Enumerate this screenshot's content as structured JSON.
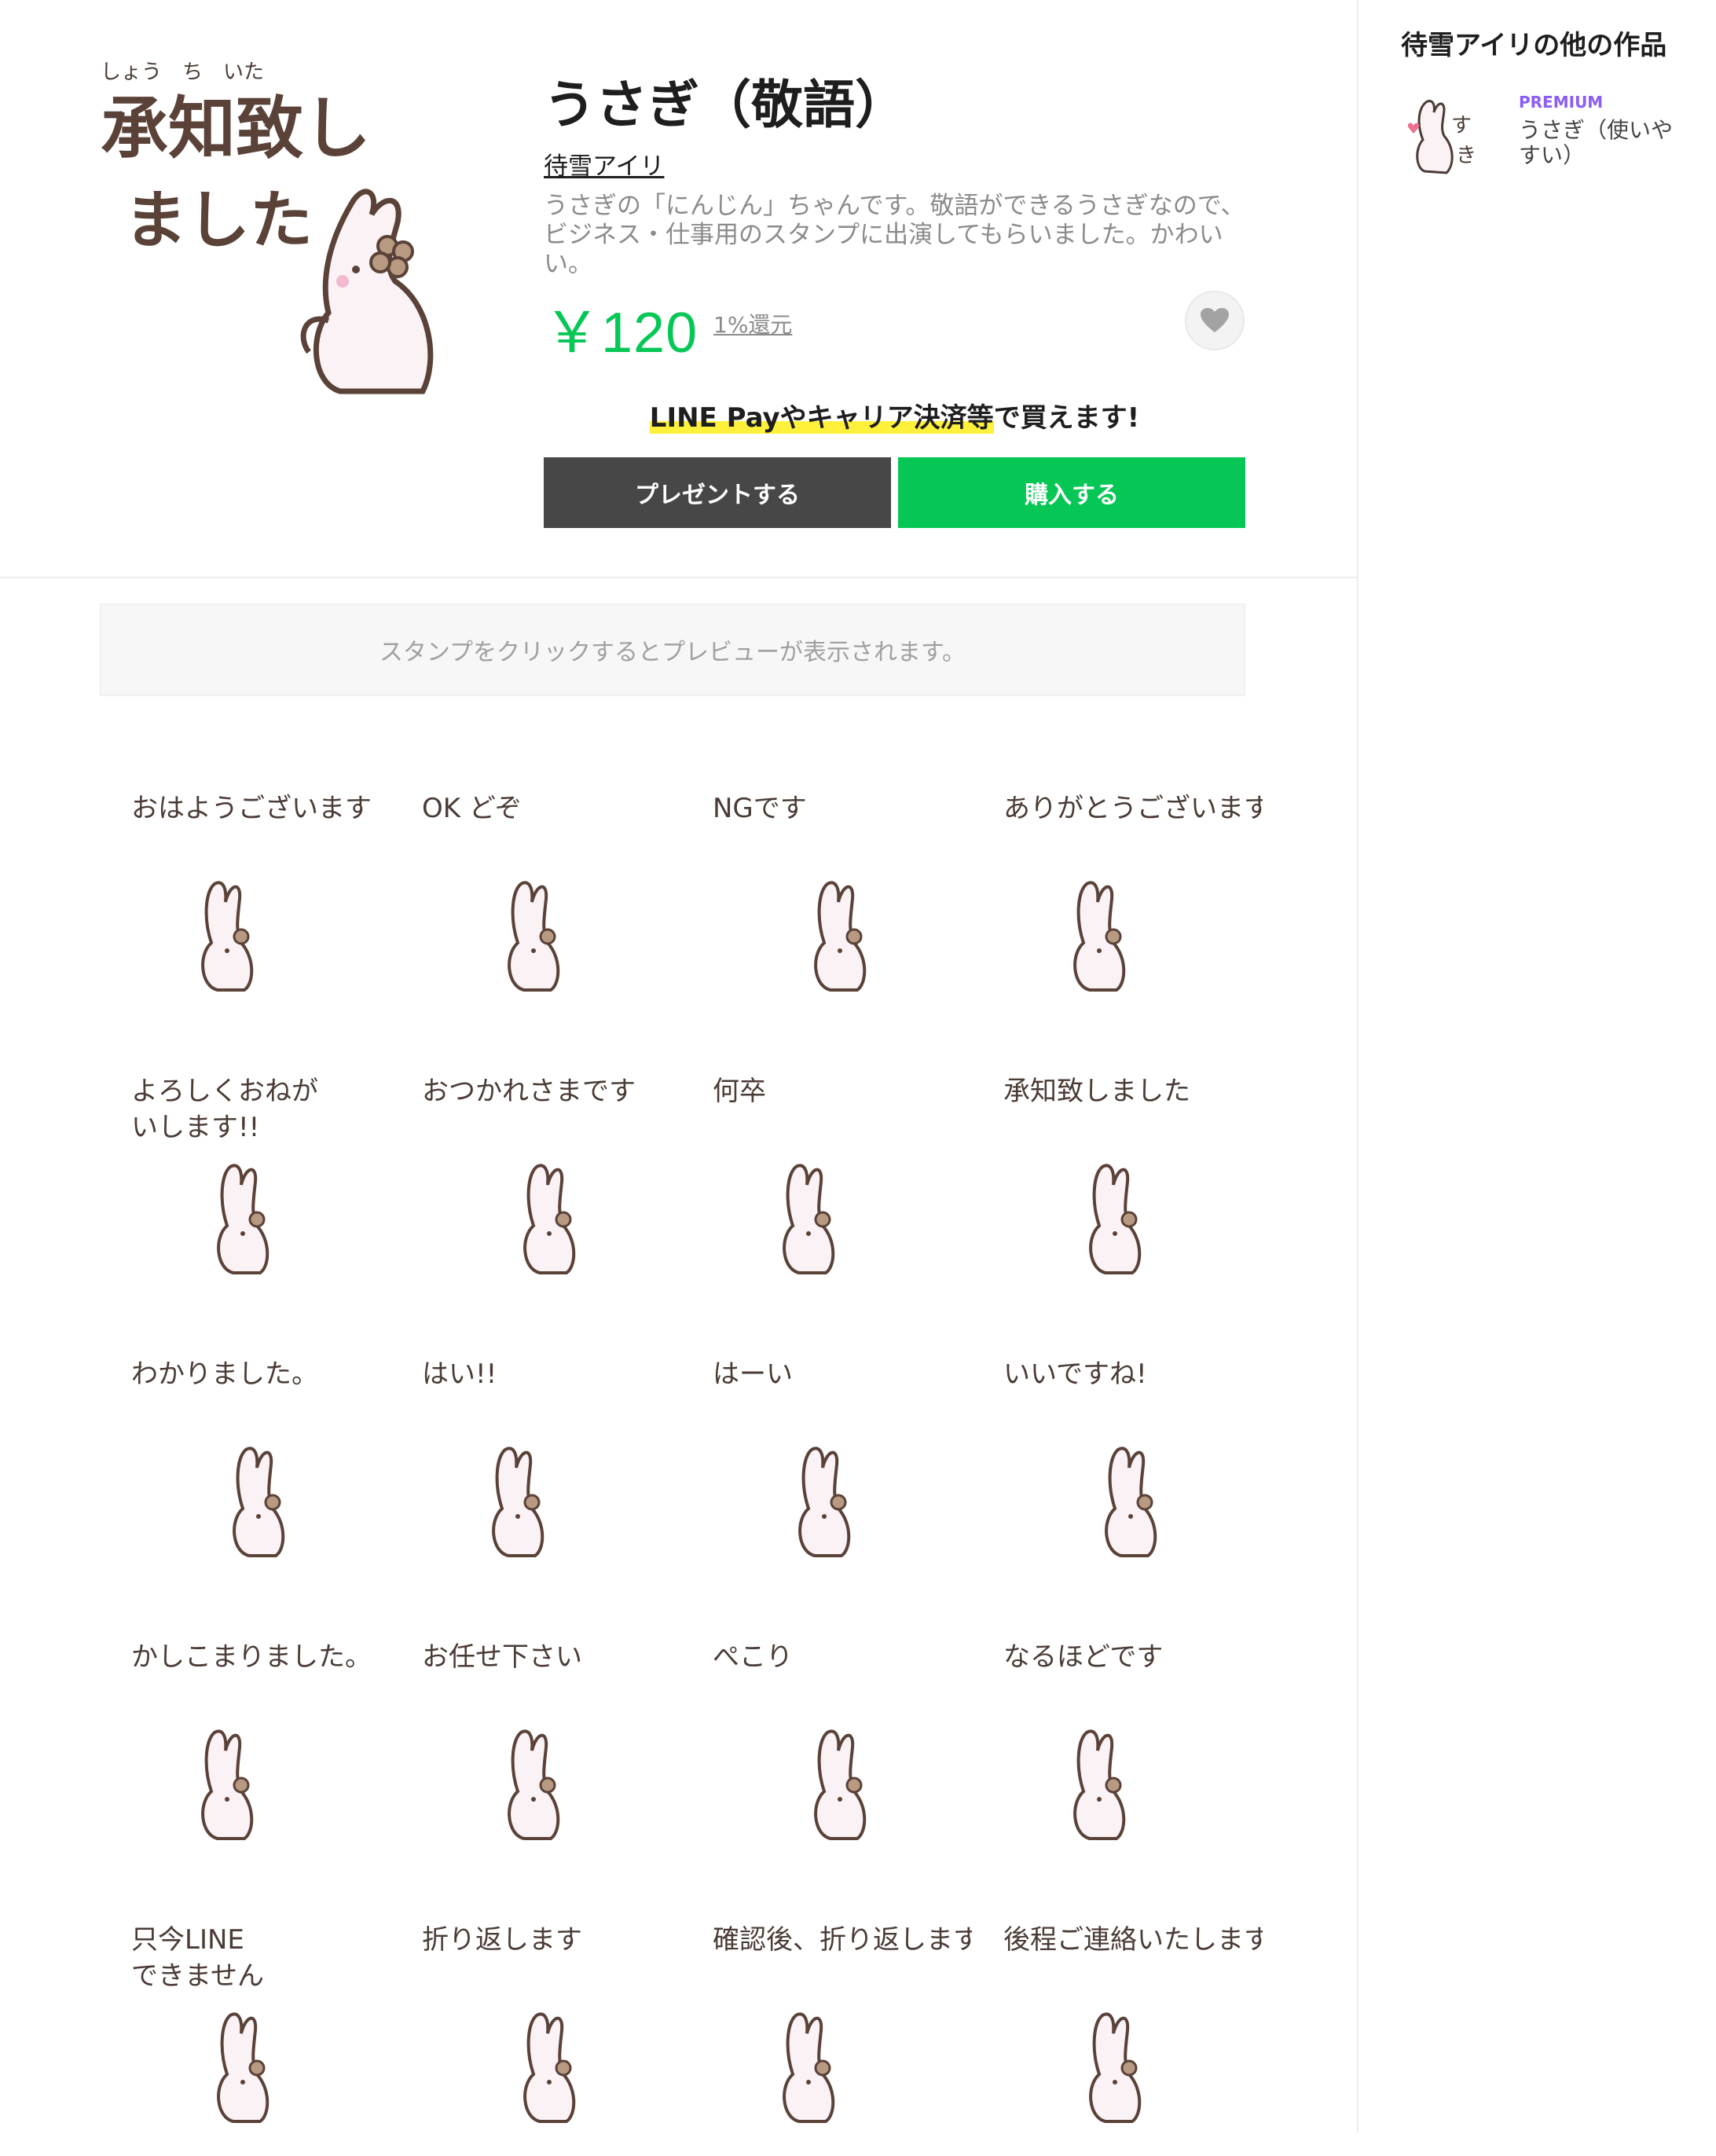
{
  "product": {
    "title": "うさぎ（敬語）",
    "author": "待雪アイリ",
    "description": "うさぎの「にんじん」ちゃんです。敬語ができるうさぎなので、ビジネス・仕事用のスタンプに出演してもらいました。かわいい。",
    "price": "￥120",
    "cashback": "1%還元",
    "hero_caption_line1": "承知致し",
    "hero_caption_line2": "ました",
    "hero_ruby": "しょう　ち　いた"
  },
  "purchase": {
    "pay_note_highlight": "LINE Payやキャリア決済等",
    "pay_note_rest": "で買えます!",
    "gift_label": "プレゼントする",
    "buy_label": "購入する"
  },
  "preview_note": "スタンプをクリックするとプレビューが表示されます。",
  "stickers": [
    {
      "caption": "おはようございます"
    },
    {
      "caption": "OK どぞ"
    },
    {
      "caption": "NGです"
    },
    {
      "caption": "ありがとうございます"
    },
    {
      "caption": "よろしくおねがいします!!"
    },
    {
      "caption": "おつかれさまです"
    },
    {
      "caption": "何卒"
    },
    {
      "caption": "承知致しました"
    },
    {
      "caption": "わかりました。"
    },
    {
      "caption": "はい!!"
    },
    {
      "caption": "はーい"
    },
    {
      "caption": "いいですね!"
    },
    {
      "caption": "かしこまりました。"
    },
    {
      "caption": "お任せ下さい"
    },
    {
      "caption": "ぺこり"
    },
    {
      "caption": "なるほどです"
    },
    {
      "caption": "只今LINEできません"
    },
    {
      "caption": "折り返します"
    },
    {
      "caption": "確認後、折り返します"
    },
    {
      "caption": "後程ご連絡いたします"
    }
  ],
  "sidebar": {
    "title": "待雪アイリの他の作品",
    "items": [
      {
        "badge": "PREMIUM",
        "name": "うさぎ（使いやすい）"
      }
    ]
  },
  "colors": {
    "accent": "#06c755",
    "gift_button": "#474747",
    "premium": "#8b5cf6",
    "highlight": "#fff03b"
  },
  "icons": {
    "favorite": "heart-icon"
  }
}
